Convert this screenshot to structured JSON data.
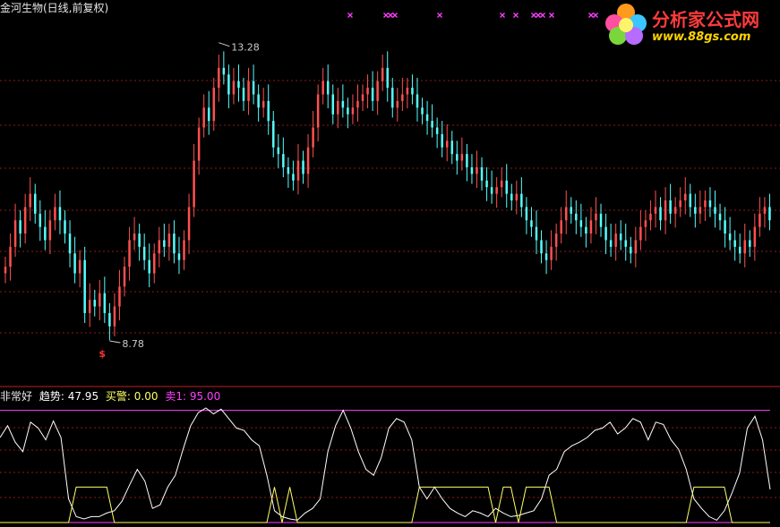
{
  "title": "金河生物(日线,前复权)",
  "price_high_label": "13.28",
  "price_low_label": "8.78",
  "signal_marker": "$",
  "indicator": {
    "name": "非常好",
    "trend_label": "趋势:",
    "trend_value": "47.95",
    "buy_label": "买警:",
    "buy_value": "0.00",
    "sell_label": "卖1:",
    "sell_value": "95.00"
  },
  "logo": {
    "title": "分析家公式网",
    "url": "www.88gs.com"
  },
  "colors": {
    "up": "#ff5050",
    "down": "#54ffff",
    "trend_line": "#ffffff",
    "alert_line": "#ffff66",
    "sell_line": "#ff40ff",
    "grid": "#8b1a1a",
    "marker": "#ff40ff"
  },
  "chart_data": {
    "type": "candlestick",
    "series": "daily",
    "price_range": [
      8.2,
      13.6
    ],
    "high_marker": 13.28,
    "low_marker": 8.78,
    "closes": [
      9.9,
      10.2,
      10.6,
      10.4,
      10.8,
      11.0,
      10.7,
      10.5,
      10.3,
      10.6,
      10.8,
      10.6,
      10.4,
      10.1,
      9.8,
      10.0,
      9.2,
      9.4,
      9.3,
      9.5,
      9.2,
      9.0,
      9.3,
      9.6,
      9.9,
      10.3,
      10.4,
      10.2,
      10.0,
      9.8,
      10.1,
      10.3,
      10.2,
      10.4,
      10.1,
      10.0,
      10.3,
      10.8,
      11.5,
      12.0,
      12.3,
      12.1,
      12.6,
      12.9,
      12.8,
      12.5,
      12.7,
      12.6,
      12.4,
      12.7,
      12.5,
      12.3,
      12.4,
      12.1,
      11.7,
      11.6,
      11.4,
      11.3,
      11.2,
      11.5,
      11.3,
      11.7,
      12.0,
      12.5,
      12.7,
      12.5,
      12.2,
      12.4,
      12.3,
      12.2,
      12.3,
      12.4,
      12.5,
      12.6,
      12.4,
      12.7,
      12.9,
      12.6,
      12.3,
      12.4,
      12.5,
      12.6,
      12.5,
      12.3,
      12.2,
      12.1,
      12.0,
      11.9,
      11.7,
      11.8,
      11.6,
      11.5,
      11.6,
      11.4,
      11.3,
      11.4,
      11.2,
      11.1,
      11.0,
      11.1,
      11.2,
      11.0,
      10.9,
      11.0,
      10.8,
      10.6,
      10.5,
      10.3,
      10.1,
      10.0,
      10.2,
      10.4,
      10.6,
      10.8,
      10.7,
      10.6,
      10.5,
      10.4,
      10.6,
      10.7,
      10.5,
      10.3,
      10.2,
      10.4,
      10.3,
      10.2,
      10.1,
      10.3,
      10.5,
      10.6,
      10.7,
      10.8,
      10.6,
      10.9,
      10.7,
      10.8,
      10.9,
      11.0,
      10.8,
      10.7,
      10.8,
      10.9,
      10.8,
      10.7,
      10.6,
      10.4,
      10.3,
      10.2,
      10.1,
      10.3,
      10.2,
      10.5,
      10.7,
      10.8,
      10.6
    ],
    "indicator_range": [
      0,
      100
    ],
    "trend": [
      72,
      82,
      68,
      60,
      85,
      80,
      70,
      86,
      72,
      20,
      5,
      3,
      5,
      5,
      8,
      10,
      18,
      32,
      45,
      35,
      12,
      15,
      30,
      40,
      62,
      82,
      93,
      97,
      92,
      96,
      88,
      80,
      78,
      70,
      65,
      40,
      10,
      5,
      3,
      2,
      8,
      12,
      20,
      60,
      82,
      95,
      80,
      60,
      45,
      40,
      55,
      80,
      88,
      85,
      70,
      30,
      20,
      30,
      20,
      12,
      8,
      5,
      10,
      8,
      5,
      12,
      8,
      5,
      6,
      8,
      10,
      20,
      40,
      45,
      60,
      65,
      68,
      72,
      78,
      80,
      85,
      75,
      80,
      88,
      85,
      70,
      85,
      83,
      70,
      62,
      45,
      20,
      12,
      5,
      2,
      10,
      25,
      42,
      80,
      90,
      70,
      28
    ],
    "alert": [
      0,
      0,
      0,
      0,
      0,
      0,
      0,
      0,
      0,
      0,
      30,
      30,
      30,
      30,
      30,
      0,
      0,
      0,
      0,
      0,
      0,
      0,
      0,
      0,
      0,
      0,
      0,
      0,
      0,
      0,
      0,
      0,
      0,
      0,
      0,
      0,
      30,
      0,
      30,
      0,
      0,
      0,
      0,
      0,
      0,
      0,
      0,
      0,
      0,
      0,
      0,
      0,
      0,
      0,
      0,
      30,
      30,
      30,
      30,
      30,
      30,
      30,
      30,
      30,
      30,
      0,
      30,
      30,
      0,
      30,
      30,
      30,
      30,
      0,
      0,
      0,
      0,
      0,
      0,
      0,
      0,
      0,
      0,
      0,
      0,
      0,
      0,
      0,
      0,
      0,
      0,
      30,
      30,
      30,
      30,
      30,
      0,
      0,
      0,
      0,
      0,
      0
    ],
    "sell_level": 95,
    "cross_markers": 13
  }
}
